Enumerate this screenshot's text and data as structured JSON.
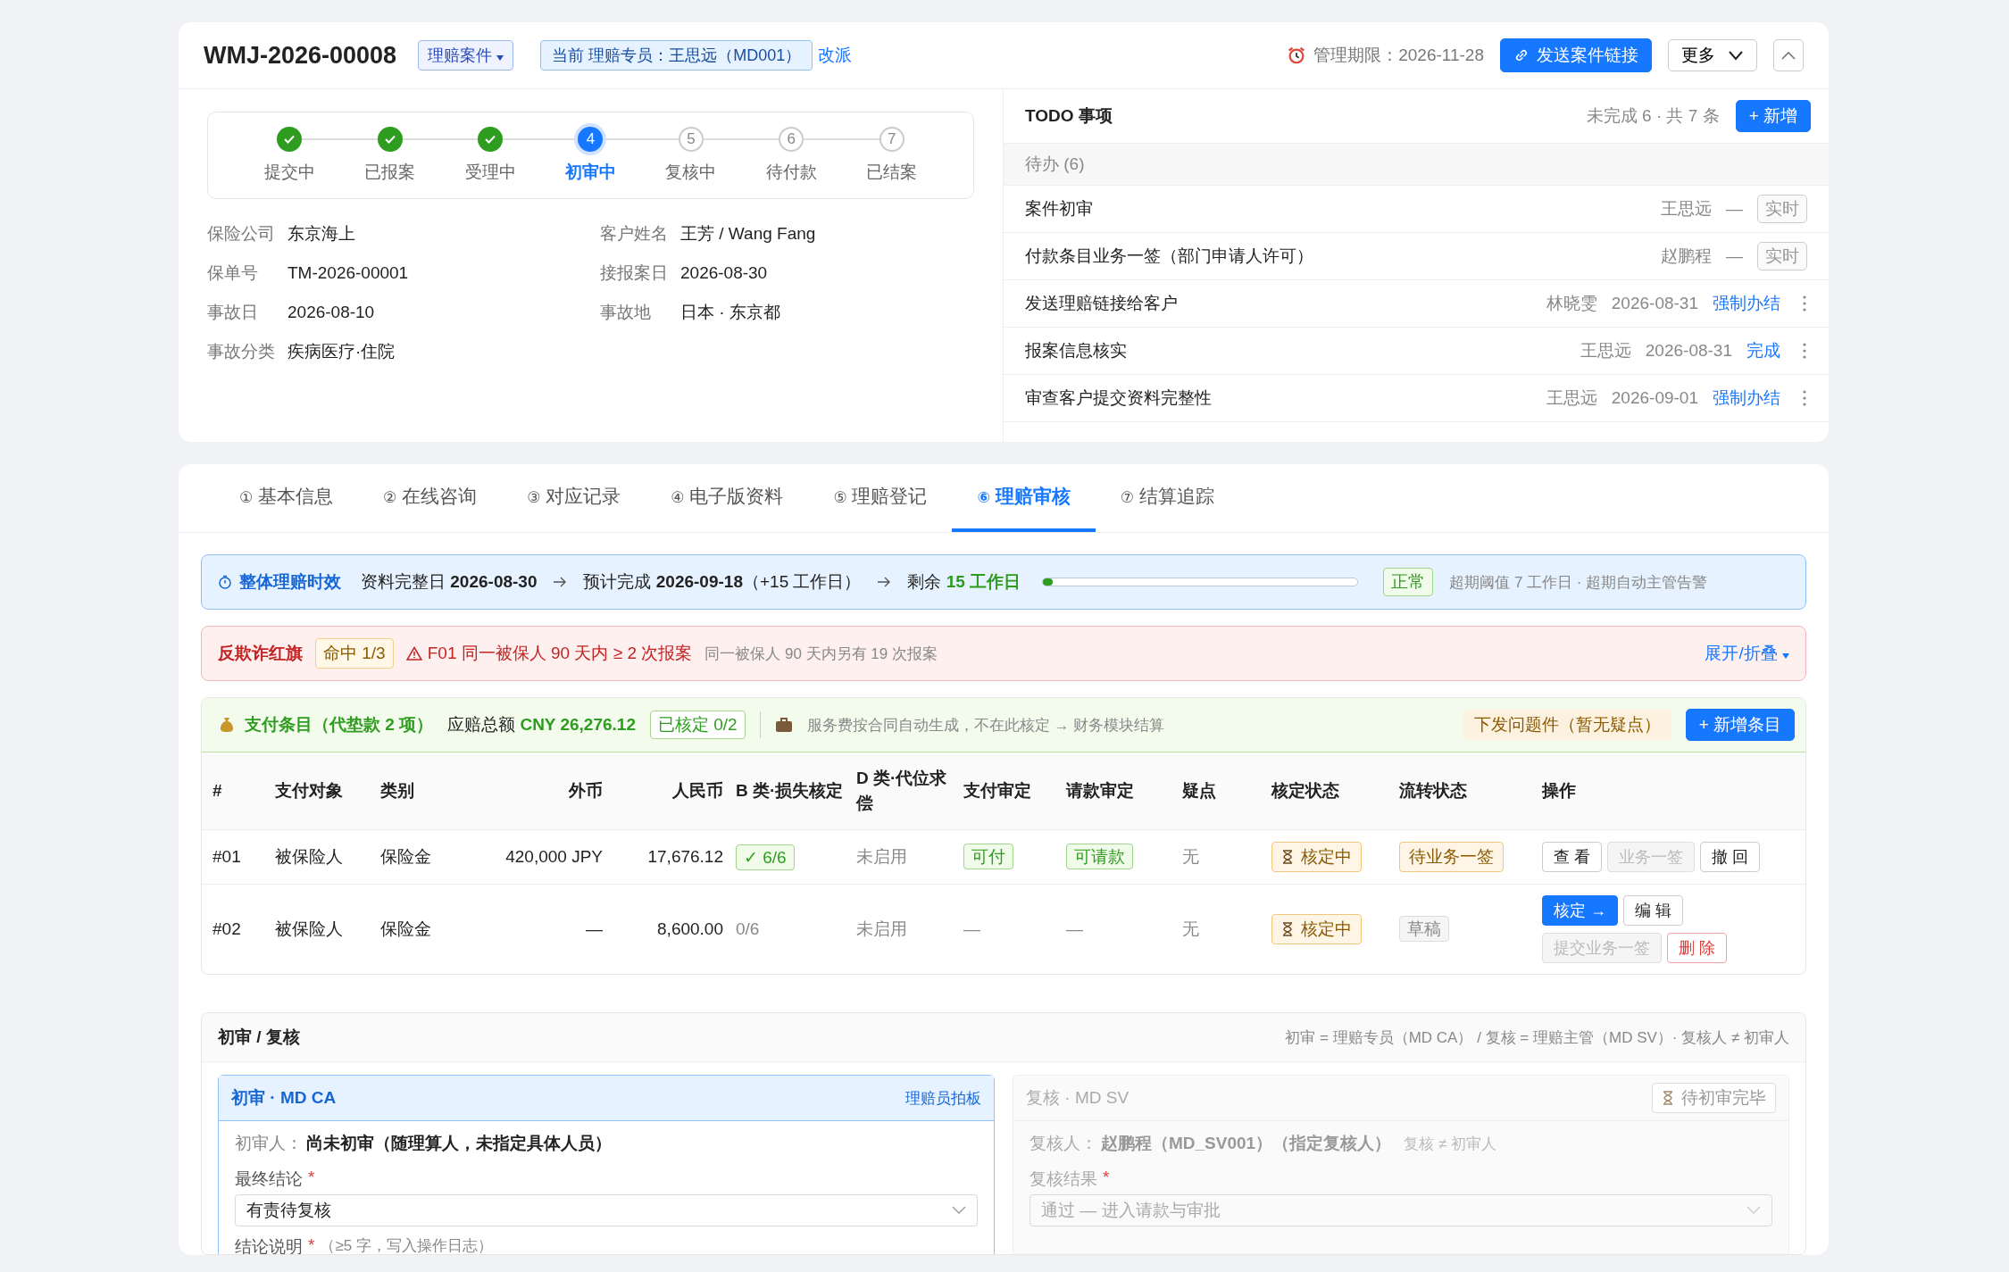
{
  "header": {
    "case_no": "WMJ-2026-00008",
    "type_tag": "理赔案件",
    "assignee": "当前 理赔专员：王思远（MD001）",
    "reassign_link": "改派",
    "deadline_label": "管理期限：",
    "deadline": "2026-11-28",
    "send_button": "发送案件链接",
    "more_button": "更多"
  },
  "steps": [
    {
      "label": "提交中",
      "kind": "done"
    },
    {
      "label": "已报案",
      "kind": "done"
    },
    {
      "label": "受理中",
      "kind": "done"
    },
    {
      "number": "4",
      "label": "初审中",
      "kind": "current"
    },
    {
      "number": "5",
      "label": "复核中",
      "kind": "pending"
    },
    {
      "number": "6",
      "label": "待付款",
      "kind": "pending"
    },
    {
      "number": "7",
      "label": "已结案",
      "kind": "pending"
    }
  ],
  "info": [
    {
      "label": "保险公司",
      "value": "东京海上"
    },
    {
      "label": "客户姓名",
      "value": "王芳 / Wang Fang"
    },
    {
      "label": "保单号",
      "value": "TM-2026-00001"
    },
    {
      "label": "接报案日",
      "value": "2026-08-30"
    },
    {
      "label": "事故日",
      "value": "2026-08-10"
    },
    {
      "label": "事故地",
      "value": "日本 · 东京都"
    },
    {
      "label": "事故分类",
      "value": "疾病医疗·住院"
    }
  ],
  "todo": {
    "title": "TODO 事项",
    "summary": "未完成 6 · 共 7 条",
    "add_button": "+ 新增",
    "group_label": "待办 (6)",
    "items": [
      {
        "title": "案件初审",
        "assignee": "王思远",
        "date": "—",
        "action": "实时",
        "kind": "tag"
      },
      {
        "title": "付款条目业务一签（部门申请人许可）",
        "assignee": "赵鹏程",
        "date": "—",
        "action": "实时",
        "kind": "tag"
      },
      {
        "title": "发送理赔链接给客户",
        "assignee": "林晓雯",
        "date": "2026-08-31",
        "action": "强制办结",
        "kind": "link"
      },
      {
        "title": "报案信息核实",
        "assignee": "王思远",
        "date": "2026-08-31",
        "action": "完成",
        "kind": "link"
      },
      {
        "title": "审查客户提交资料完整性",
        "assignee": "王思远",
        "date": "2026-09-01",
        "action": "强制办结",
        "kind": "link"
      }
    ]
  },
  "tabs": [
    {
      "number": "①",
      "label": "基本信息",
      "selected": false
    },
    {
      "number": "②",
      "label": "在线咨询",
      "selected": false
    },
    {
      "number": "③",
      "label": "对应记录",
      "selected": false
    },
    {
      "number": "④",
      "label": "电子版资料",
      "selected": false
    },
    {
      "number": "⑤",
      "label": "理赔登记",
      "selected": false
    },
    {
      "number": "⑥",
      "label": "理赔审核",
      "selected": true
    },
    {
      "number": "⑦",
      "label": "结算追踪",
      "selected": false
    }
  ],
  "timeline": {
    "title": "整体理赔时效",
    "complete_label": "资料完整日",
    "complete_date": "2026-08-30",
    "expected_label": "预计完成",
    "expected_date": "2026-09-18",
    "expected_note": "（+15 工作日）",
    "remaining_label": "剩余",
    "remaining": "15 工作日",
    "level": 0.03,
    "status": "正常",
    "note": "超期阈值 7 工作日 · 超期自动主管告警"
  },
  "fraud": {
    "title": "反欺诈红旗",
    "hit_badge": "命中 1/3",
    "rule": "F01 同一被保人 90 天内 ≥ 2 次报案",
    "detail": "同一被保人 90 天内另有 19 次报案",
    "toggle": "展开/折叠"
  },
  "payments": {
    "title": "支付条目（代垫款 2 项）",
    "total_label": "应赔总额",
    "total": "CNY 26,276.12",
    "verified": "已核定 0/2",
    "note": "服务费按合同自动生成，不在此核定 → 财务模块结算",
    "issue_button": "下发问题件（暂无疑点）",
    "add_button": "+ 新增条目",
    "columns": [
      "#",
      "支付对象",
      "类别",
      "外币",
      "人民币",
      "B 类·损失核定",
      "D 类·代位求偿",
      "支付审定",
      "请款审定",
      "疑点",
      "核定状态",
      "流转状态",
      "操作"
    ],
    "rows": [
      {
        "no": "#01",
        "payee": "被保险人",
        "category": "保险金",
        "foreign": "420,000 JPY",
        "rmb": "17,676.12",
        "b_class": {
          "text": "✓ 6/6",
          "kind": "ok"
        },
        "d_class": "未启用",
        "pay_review": {
          "text": "可付",
          "kind": "tag"
        },
        "request_review": {
          "text": "可请款",
          "kind": "tag"
        },
        "doubt": "无",
        "verify_status": "核定中",
        "flow_status": {
          "text": "待业务一签",
          "kind": "warn"
        },
        "actions": [
          {
            "label": "查 看",
            "kind": "default"
          },
          {
            "label": "业务一签",
            "kind": "disabled"
          },
          {
            "label": "撤 回",
            "kind": "default"
          }
        ]
      },
      {
        "no": "#02",
        "payee": "被保险人",
        "category": "保险金",
        "foreign": "—",
        "rmb": "8,600.00",
        "b_class": {
          "text": "0/6",
          "kind": "plain"
        },
        "d_class": "未启用",
        "pay_review": {
          "text": "—",
          "kind": "dash"
        },
        "request_review": {
          "text": "—",
          "kind": "dash"
        },
        "doubt": "无",
        "verify_status": "核定中",
        "flow_status": {
          "text": "草稿",
          "kind": "grey"
        },
        "actions": [
          {
            "label": "核定 →",
            "kind": "primary"
          },
          {
            "label": "编 辑",
            "kind": "default"
          },
          {
            "label": "提交业务一签",
            "kind": "disabled"
          },
          {
            "label": "删 除",
            "kind": "danger"
          }
        ]
      }
    ]
  },
  "review": {
    "title": "初审 / 复核",
    "note": "初审 = 理赔专员（MD CA） / 复核 = 理赔主管（MD SV）· 复核人 ≠ 初审人",
    "first": {
      "title": "初审 · MD CA",
      "badge": "理赔员拍板",
      "person_label": "初审人：",
      "person": "尚未初审（随理算人，未指定具体人员）",
      "conclusion_label": "最终结论",
      "required_mark": "*",
      "conclusion": "有责待复核",
      "explain_label": "结论说明",
      "explain_hint": "（≥5 字，写入操作日志）"
    },
    "second": {
      "title": "复核 · MD SV",
      "badge": "待初审完毕",
      "disabled": true,
      "person_label": "复核人：",
      "person": "赵鹏程（MD_SV001）（指定复核人）",
      "person_note": "复核 ≠ 初审人",
      "result_label": "复核结果",
      "required_mark": "*",
      "result": "通过 — 进入请款与审批"
    }
  }
}
